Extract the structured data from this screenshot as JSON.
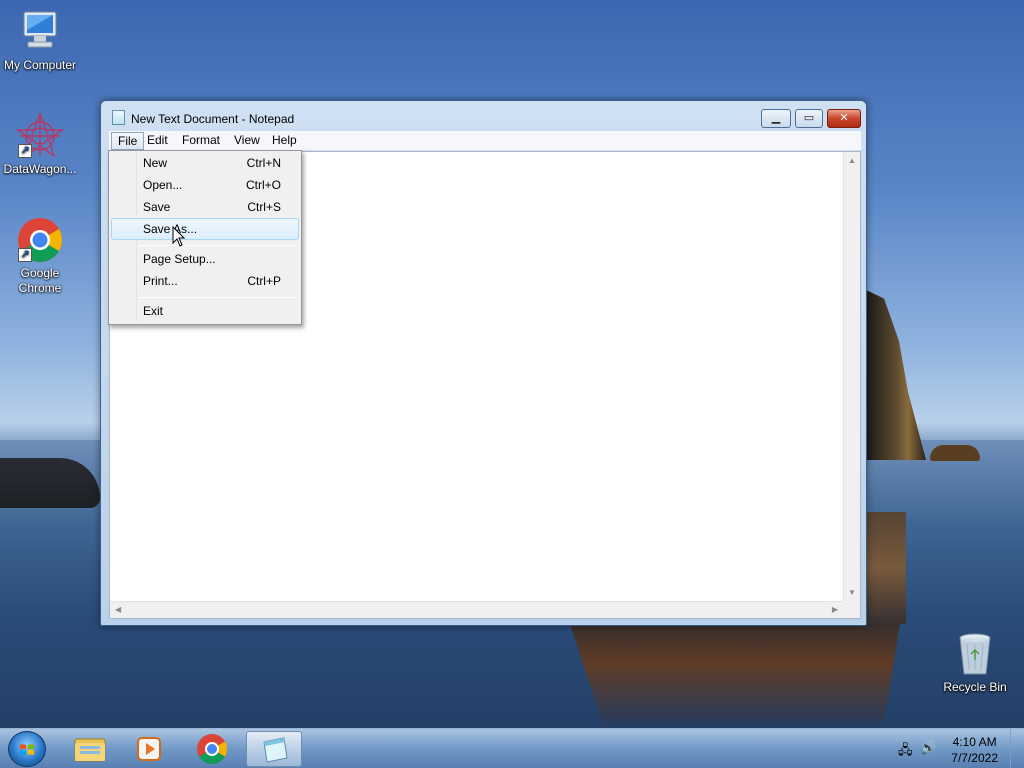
{
  "desktop": {
    "icons": [
      {
        "label": "My Computer",
        "icon": "computer-icon"
      },
      {
        "label": "DataWagon...",
        "icon": "datawagon-icon"
      },
      {
        "label": "Google Chrome",
        "icon": "chrome-icon"
      },
      {
        "label": "Recycle Bin",
        "icon": "recycle-bin-icon"
      }
    ]
  },
  "window": {
    "title": "New Text Document - Notepad",
    "buttons": {
      "minimize": "minimize-icon",
      "maximize": "maximize-icon",
      "close": "close-icon"
    },
    "menus": [
      {
        "label": "File",
        "active": true
      },
      {
        "label": "Edit"
      },
      {
        "label": "Format"
      },
      {
        "label": "View"
      },
      {
        "label": "Help"
      }
    ],
    "content": ""
  },
  "file_menu": {
    "items": [
      {
        "label": "New",
        "shortcut": "Ctrl+N"
      },
      {
        "label": "Open...",
        "shortcut": "Ctrl+O"
      },
      {
        "label": "Save",
        "shortcut": "Ctrl+S"
      },
      {
        "label": "Save As...",
        "shortcut": "",
        "hovered": true
      },
      {
        "label": "Page Setup...",
        "shortcut": ""
      },
      {
        "label": "Print...",
        "shortcut": "Ctrl+P"
      },
      {
        "label": "Exit",
        "shortcut": ""
      }
    ]
  },
  "taskbar": {
    "pinned": [
      {
        "name": "explorer",
        "icon": "folder-icon"
      },
      {
        "name": "media-player",
        "icon": "media-player-icon"
      },
      {
        "name": "chrome",
        "icon": "chrome-icon"
      },
      {
        "name": "notepad",
        "icon": "notepad-icon",
        "active": true
      }
    ],
    "clock": {
      "time": "4:10 AM",
      "date": "7/7/2022"
    }
  }
}
